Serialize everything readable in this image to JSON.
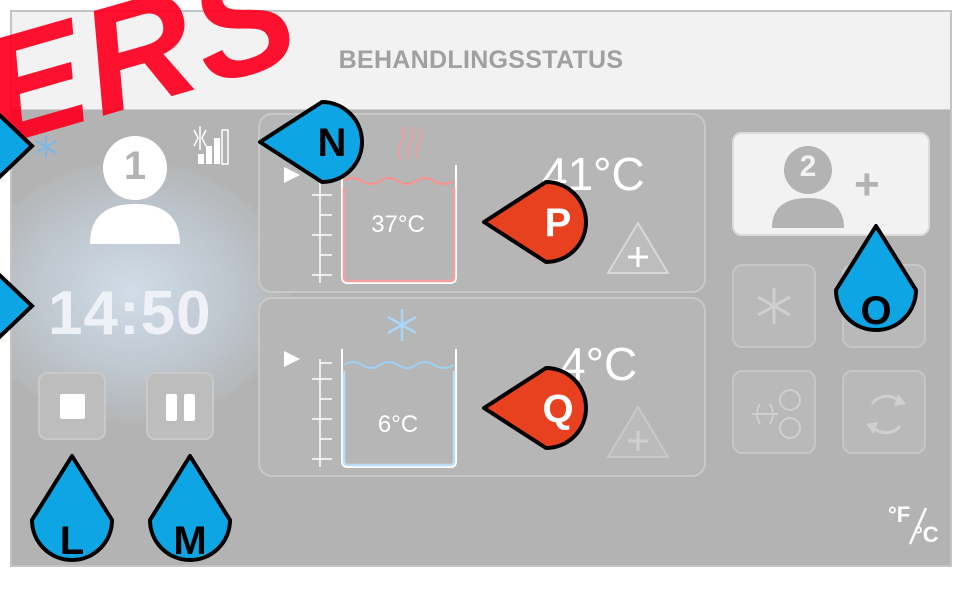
{
  "watermark": "ERS",
  "header": {
    "title": "BEHANDLINGSSTATUS"
  },
  "patient1": {
    "number": "1",
    "time": "14:50"
  },
  "tank_hot": {
    "water_temp": "37°C",
    "target_temp": "41°C"
  },
  "tank_cold": {
    "water_temp": "6°C",
    "target_temp": "4°C"
  },
  "patient2": {
    "number": "2",
    "add_symbol": "+"
  },
  "unit_toggle": {
    "label_f": "°F",
    "label_c": "°C"
  },
  "callouts": {
    "L": "L",
    "M": "M",
    "N": "N",
    "O": "O",
    "P": "P",
    "Q": "Q"
  },
  "colors": {
    "accent_blue": "#0ea5e4",
    "accent_red": "#e8411f",
    "watermark_red": "#ff0020",
    "bar_gray": "#b3b3b3"
  }
}
